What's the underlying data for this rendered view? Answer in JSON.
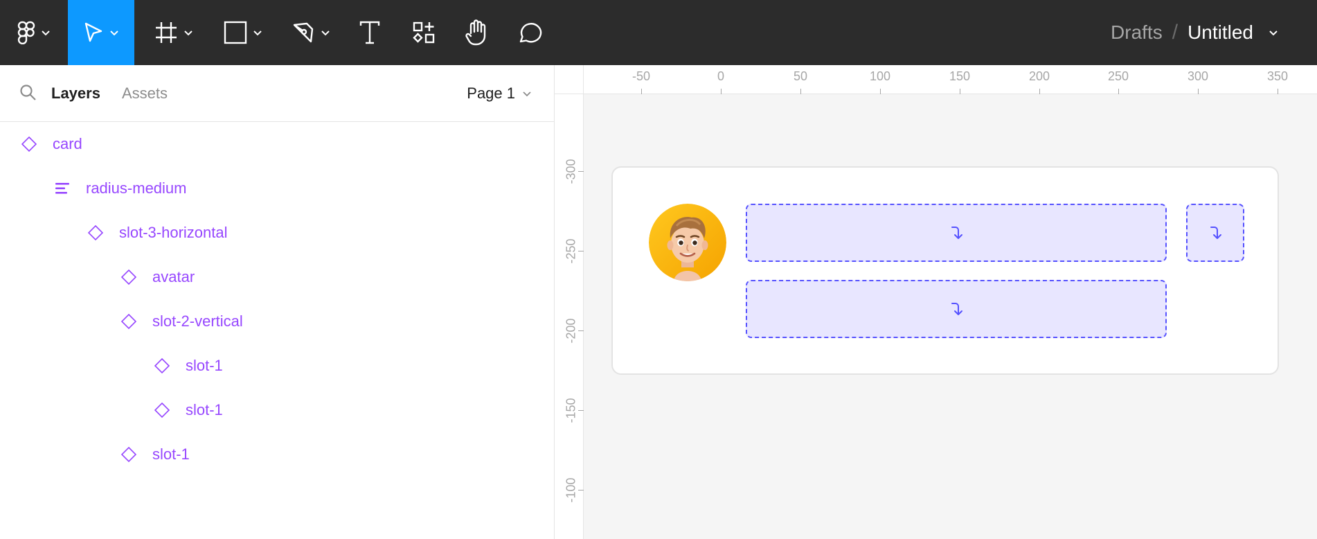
{
  "toolbar": {
    "tools": [
      {
        "name": "main-menu",
        "icon": "figma-logo-icon"
      },
      {
        "name": "move-tool",
        "icon": "cursor-arrow-icon",
        "active": true
      },
      {
        "name": "frame-tool",
        "icon": "frame-hash-icon"
      },
      {
        "name": "shape-tool",
        "icon": "rectangle-icon"
      },
      {
        "name": "pen-tool",
        "icon": "pen-icon"
      },
      {
        "name": "text-tool",
        "icon": "text-t-icon"
      },
      {
        "name": "resources-tool",
        "icon": "components-icon"
      },
      {
        "name": "hand-tool",
        "icon": "hand-icon"
      },
      {
        "name": "comment-tool",
        "icon": "comment-bubble-icon"
      }
    ],
    "active_color": "#0d99ff",
    "breadcrumb": {
      "location": "Drafts",
      "separator": "/",
      "file_name": "Untitled"
    }
  },
  "left_panel": {
    "tabs": {
      "layers": "Layers",
      "assets": "Assets"
    },
    "page_selector": "Page 1",
    "layers": [
      {
        "label": "card",
        "depth": 0,
        "icon": "component-diamond-icon"
      },
      {
        "label": "radius-medium",
        "depth": 1,
        "icon": "auto-layout-icon"
      },
      {
        "label": "slot-3-horizontal",
        "depth": 2,
        "icon": "component-diamond-icon"
      },
      {
        "label": "avatar",
        "depth": 3,
        "icon": "component-diamond-icon"
      },
      {
        "label": "slot-2-vertical",
        "depth": 3,
        "icon": "component-diamond-icon"
      },
      {
        "label": "slot-1",
        "depth": 4,
        "icon": "component-diamond-icon"
      },
      {
        "label": "slot-1",
        "depth": 4,
        "icon": "component-diamond-icon"
      },
      {
        "label": "slot-1",
        "depth": 3,
        "icon": "component-diamond-icon"
      }
    ],
    "layer_color": "#9747ff"
  },
  "canvas": {
    "ruler_top": [
      "-50",
      "0",
      "50",
      "100",
      "150",
      "200",
      "250",
      "300",
      "350"
    ],
    "ruler_left": [
      "-300",
      "-250",
      "-200",
      "-150",
      "-100"
    ],
    "slot_color": "#5551ff",
    "slot_fill": "#e8e6ff",
    "slots": [
      {
        "name": "slot-1",
        "icon": "instance-swap-icon"
      },
      {
        "name": "slot-1",
        "icon": "instance-swap-icon"
      },
      {
        "name": "slot-1",
        "icon": "instance-swap-icon"
      }
    ],
    "avatar_bg": "#f5b800"
  }
}
